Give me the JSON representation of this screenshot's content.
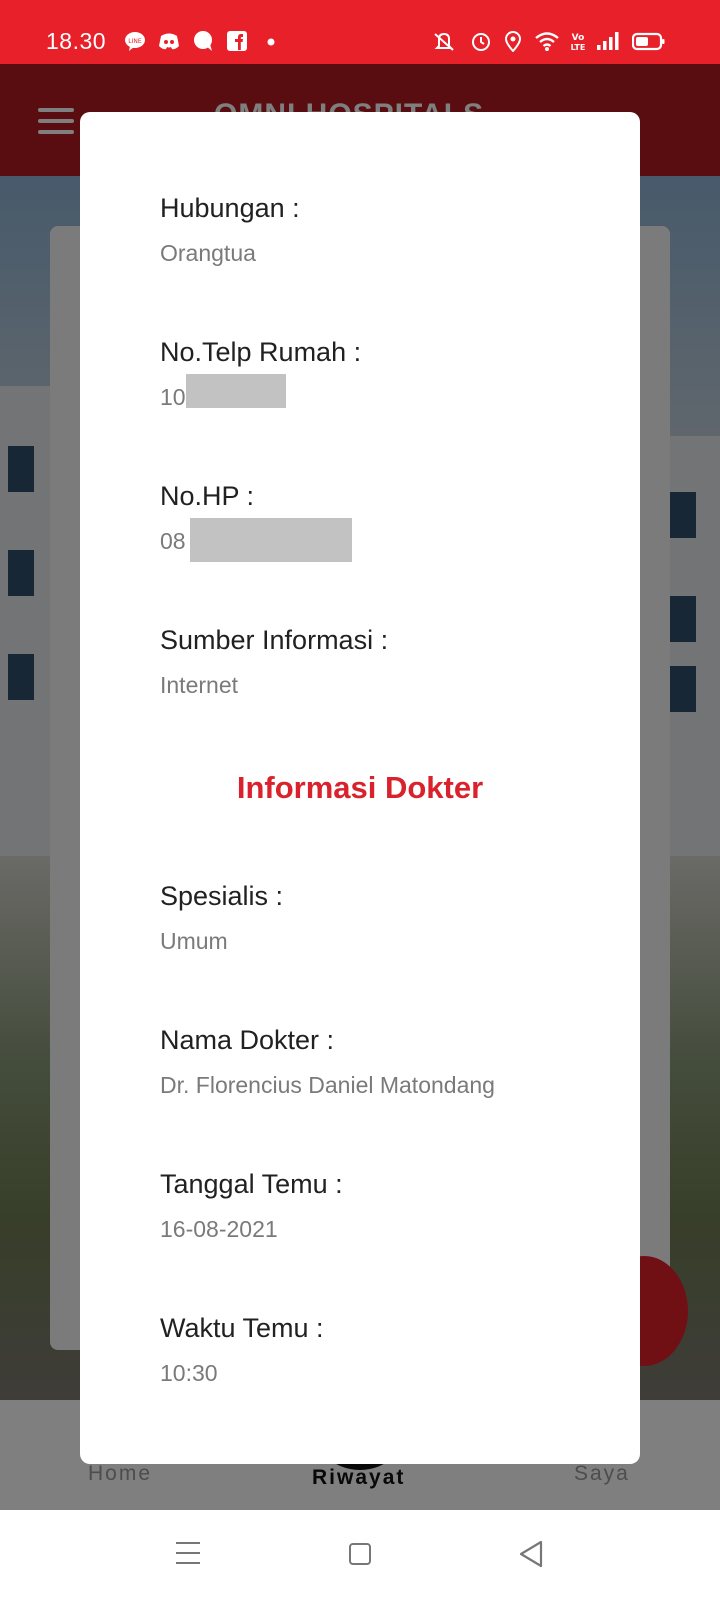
{
  "status_bar": {
    "time": "18.30",
    "left_icons": [
      "line-icon",
      "discord-icon",
      "chat-bubble-icon",
      "facebook-icon",
      "dot-icon"
    ],
    "right_icons": [
      "mute-icon",
      "alarm-icon",
      "location-icon",
      "wifi-icon",
      "volte-icon",
      "signal-icon",
      "battery-icon"
    ],
    "color": "#e8202a"
  },
  "app_bar": {
    "title": "OMNI HOSPITALS"
  },
  "bottom_nav": {
    "items": [
      {
        "label": "Home",
        "active": false
      },
      {
        "label": "Riwayat",
        "active": true
      },
      {
        "label": "Saya",
        "active": false
      }
    ]
  },
  "dialog": {
    "fields_top": [
      {
        "label": "Hubungan :",
        "value": "Orangtua"
      },
      {
        "label": "No.Telp Rumah :",
        "value": "10"
      },
      {
        "label": "No.HP :",
        "value": "08"
      },
      {
        "label": "Sumber Informasi :",
        "value": "Internet"
      }
    ],
    "section_title": "Informasi Dokter",
    "fields_doctor": [
      {
        "label": "Spesialis :",
        "value": "Umum"
      },
      {
        "label": "Nama Dokter :",
        "value": "Dr. Florencius Daniel Matondang"
      },
      {
        "label": "Tanggal Temu :",
        "value": "16-08-2021"
      },
      {
        "label": "Waktu Temu :",
        "value": "10:30"
      }
    ]
  },
  "colors": {
    "accent": "#d9222b",
    "label": "#212121",
    "value": "#7a7a7a"
  }
}
